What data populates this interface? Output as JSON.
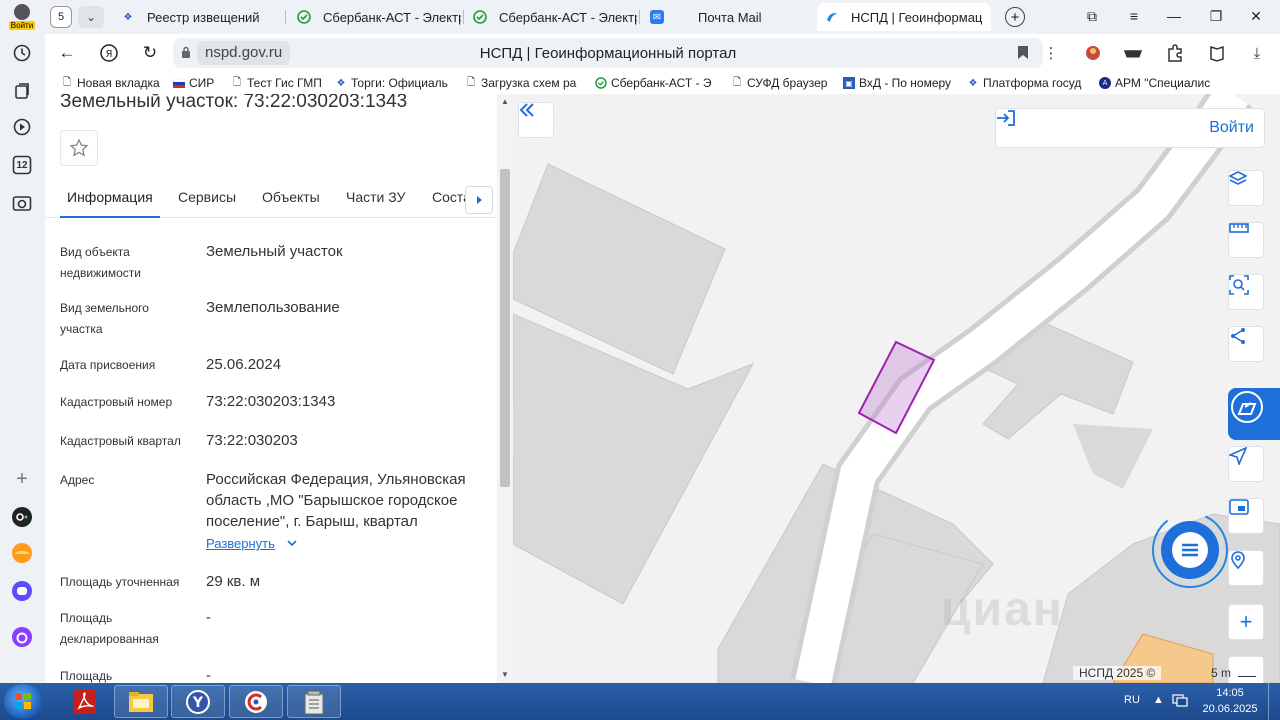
{
  "sidebar": {
    "login_label": "Войти",
    "badge_count": "12"
  },
  "tabs": {
    "count": "5",
    "items": [
      {
        "title": "Реестр извещений",
        "favicon": "gerb-icon",
        "active": false
      },
      {
        "title": "Сбербанк-АСТ - Электр",
        "favicon": "sber-icon",
        "active": false
      },
      {
        "title": "Сбербанк-АСТ - Электр",
        "favicon": "sber-icon",
        "active": false
      },
      {
        "title": "Почта Mail",
        "favicon": "mail-icon",
        "active": false
      },
      {
        "title": "НСПД | Геоинформац",
        "favicon": "nspd-icon",
        "active": true
      }
    ]
  },
  "address": {
    "domain": "nspd.gov.ru",
    "page_title": "НСПД | Геоинформационный портал"
  },
  "bookmarks": [
    "Новая вкладка",
    "СИР",
    "Тест Гис ГМП",
    "Торги: Официаль",
    "Загрузка схем ра",
    "Сбербанк-АСТ - Э",
    "СУФД браузер",
    "ВхД - По номеру",
    "Платформа госуд",
    "АРМ \"Специалис"
  ],
  "panel": {
    "title": "Земельный участок: 73:22:030203:1343",
    "tabs": [
      "Информация",
      "Сервисы",
      "Объекты",
      "Части ЗУ",
      "Соста"
    ],
    "properties": [
      {
        "label": "Вид объекта недвижимости",
        "value": "Земельный участок"
      },
      {
        "label": "Вид земельного участка",
        "value": "Землепользование"
      },
      {
        "label": "Дата присвоения",
        "value": "25.06.2024"
      },
      {
        "label": "Кадастровый номер",
        "value": "73:22:030203:1343"
      },
      {
        "label": "Кадастровый квартал",
        "value": "73:22:030203"
      },
      {
        "label": "Адрес",
        "value": "Российская Федерация, Ульяновская область ,МО \"Барышское городское поселение\", г. Барыш, квартал"
      },
      {
        "label": "Площадь уточненная",
        "value": "29 кв. м"
      },
      {
        "label": "Площадь декларированная",
        "value": "-"
      },
      {
        "label": "Площадь",
        "value": "-"
      }
    ],
    "expand_label": "Развернуть"
  },
  "map": {
    "login_label": "Войти",
    "copyright": "НСПД 2025 ©",
    "scale": "5 m",
    "watermark": "циан",
    "parcel_color": "#a020b0"
  },
  "taskbar": {
    "lang": "RU",
    "time": "14:05",
    "date": "20.06.2025"
  }
}
